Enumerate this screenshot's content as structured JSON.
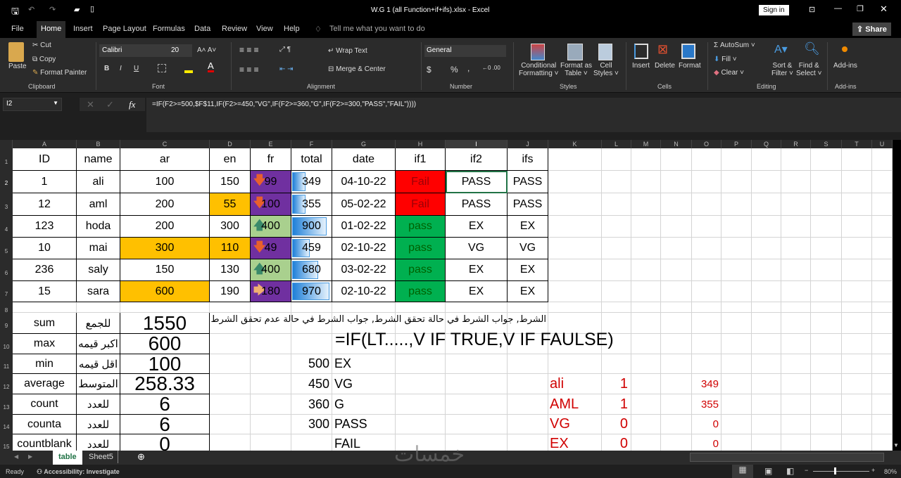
{
  "window": {
    "title": "W.G 1 (all Function+if+ifs).xlsx  -  Excel",
    "sign_in": "Sign in",
    "share": "Share"
  },
  "menu": [
    "File",
    "Home",
    "Insert",
    "Page Layout",
    "Formulas",
    "Data",
    "Review",
    "View",
    "Help"
  ],
  "tell_me": "Tell me what you want to do",
  "ribbon": {
    "clipboard": {
      "paste": "Paste",
      "cut": "Cut",
      "copy": "Copy",
      "format_painter": "Format Painter",
      "group": "Clipboard"
    },
    "font": {
      "name": "Calibri",
      "size": "20",
      "bold": "B",
      "italic": "I",
      "underline": "U",
      "group": "Font"
    },
    "alignment": {
      "wrap": "Wrap Text",
      "merge": "Merge & Center",
      "group": "Alignment"
    },
    "number": {
      "format": "General",
      "currency": "$",
      "percent": "%",
      "comma": ",",
      "group": "Number"
    },
    "styles": {
      "conditional": "Conditional",
      "conditional2": "Formatting",
      "format_table": "Format as",
      "format_table2": "Table",
      "cell_styles": "Cell",
      "cell_styles2": "Styles",
      "group": "Styles"
    },
    "cells": {
      "insert": "Insert",
      "delete": "Delete",
      "format": "Format",
      "group": "Cells"
    },
    "editing": {
      "autosum": "AutoSum",
      "fill": "Fill",
      "clear": "Clear",
      "sort": "Sort &",
      "sort2": "Filter",
      "find": "Find &",
      "find2": "Select",
      "group": "Editing"
    },
    "addins": {
      "label": "Add-ins",
      "group": "Add-ins"
    }
  },
  "formula_bar": {
    "name_box": "I2",
    "formula": "=IF(F2>=500,$F$11,IF(F2>=450,\"VG\",IF(F2>=360,\"G\",IF(F2>=300,\"PASS\",\"FAIL\"))))"
  },
  "columns": [
    "A",
    "B",
    "C",
    "D",
    "E",
    "F",
    "G",
    "H",
    "I",
    "J",
    "K",
    "L",
    "M",
    "N",
    "O",
    "P",
    "Q",
    "R",
    "S",
    "T",
    "U"
  ],
  "rows": [
    "1",
    "2",
    "3",
    "4",
    "5",
    "6",
    "7",
    "8",
    "9",
    "10",
    "11",
    "12",
    "13",
    "14",
    "15"
  ],
  "table": {
    "headers": [
      "ID",
      "name",
      "ar",
      "en",
      "fr",
      "total",
      "date",
      "if1",
      "if2",
      "ifs"
    ],
    "records": [
      [
        "1",
        "ali",
        "100",
        "150",
        "99",
        "349",
        "04-10-22",
        "Fail",
        "PASS",
        "PASS"
      ],
      [
        "12",
        "aml",
        "200",
        "55",
        "100",
        "355",
        "05-02-22",
        "Fail",
        "PASS",
        "PASS"
      ],
      [
        "123",
        "hoda",
        "200",
        "300",
        "400",
        "900",
        "01-02-22",
        "pass",
        "EX",
        "EX"
      ],
      [
        "10",
        "mai",
        "300",
        "110",
        "49",
        "459",
        "02-10-22",
        "pass",
        "VG",
        "VG"
      ],
      [
        "236",
        "saly",
        "150",
        "130",
        "400",
        "680",
        "03-02-22",
        "pass",
        "EX",
        "EX"
      ],
      [
        "15",
        "sara",
        "600",
        "190",
        "180",
        "970",
        "02-10-22",
        "pass",
        "EX",
        "EX"
      ]
    ],
    "fr_icons": [
      "arrow-down",
      "arrow-down",
      "arrow-up",
      "arrow-down",
      "arrow-up",
      "arrow-right"
    ]
  },
  "colors": {
    "orange": "#ffc000",
    "purple": "#7030a0",
    "light_green": "#a9d08e",
    "fail_red": "#ff0000",
    "pass_green": "#00b050",
    "red_text": "#d00000",
    "selected": "#217346"
  },
  "stats": [
    [
      "sum",
      "للجمع",
      "1550"
    ],
    [
      "max",
      "اكبر قيمه",
      "600"
    ],
    [
      "min",
      "اقل قيمه",
      "100"
    ],
    [
      "average",
      "المتوسط",
      "258.33"
    ],
    [
      "count",
      "للعدد",
      "6"
    ],
    [
      "counta",
      "للعدد",
      "6"
    ],
    [
      "countblank",
      "للعدد",
      "0"
    ]
  ],
  "note_arabic": "الشرط, جواب الشرط في حالة تحقق الشرط, جواب الشرط في حالة عدم تحقق الشرط",
  "note_formula": "=IF(LT.....,V IF TRUE,V IF FAULSE)",
  "grades": [
    [
      "500",
      "EX"
    ],
    [
      "450",
      "VG"
    ],
    [
      "360",
      "G"
    ],
    [
      "300",
      "PASS"
    ],
    [
      "",
      "FAIL"
    ]
  ],
  "counts": [
    [
      "ali",
      "1",
      "349"
    ],
    [
      "AML",
      "1",
      "355"
    ],
    [
      "VG",
      "0",
      "0"
    ],
    [
      "EX",
      "0",
      "0"
    ]
  ],
  "sheets": [
    "table",
    "Sheet5"
  ],
  "status": {
    "ready": "Ready",
    "accessibility": "Accessibility: Investigate",
    "zoom": "80%"
  }
}
